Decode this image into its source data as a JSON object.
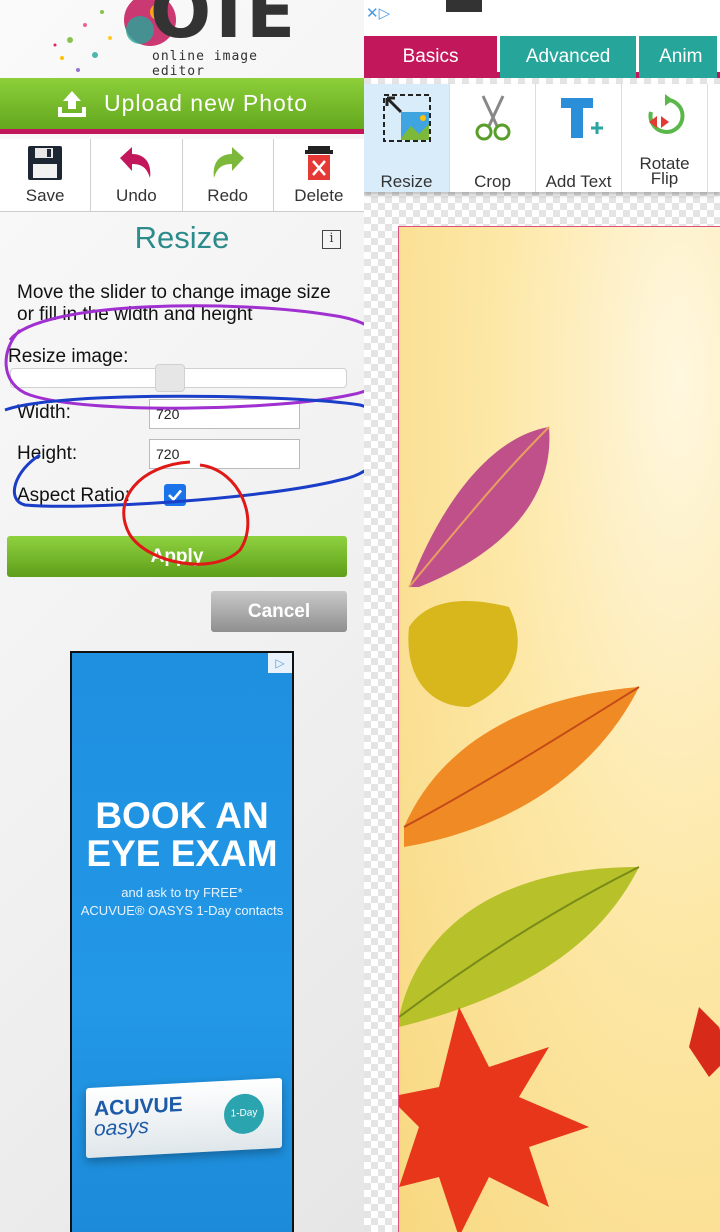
{
  "logo": {
    "text": "online image editor",
    "mark": "OIE"
  },
  "upload": {
    "label": "Upload new Photo"
  },
  "toolbar": {
    "save": "Save",
    "undo": "Undo",
    "redo": "Redo",
    "delete": "Delete"
  },
  "panel": {
    "title": "Resize",
    "info_icon": "i",
    "description": "Move the slider to change image size or fill in the width and height",
    "resize_label": "Resize image:",
    "width_label": "Width:",
    "width_value": "720",
    "height_label": "Height:",
    "height_value": "720",
    "aspect_label": "Aspect Ratio:",
    "aspect_checked": true,
    "apply": "Apply",
    "cancel": "Cancel"
  },
  "ad": {
    "headline": "BOOK AN EYE EXAM",
    "sub1": "and ask to try FREE*",
    "sub2": "ACUVUE® OASYS 1-Day contacts",
    "brand1": "ACUVUE",
    "brand2": "oasys",
    "seal": "1-Day",
    "choices_icon": "▷"
  },
  "topbar": {
    "close_icon": "✕▷"
  },
  "tabs": [
    {
      "label": "Basics",
      "color": "#c2185b"
    },
    {
      "label": "Advanced",
      "color": "#26a69a"
    },
    {
      "label": "Anim",
      "color": "#26a69a"
    }
  ],
  "tools": {
    "resize": "Resize",
    "crop": "Crop",
    "add_text": "Add Text",
    "rotate1": "Rotate",
    "rotate2": "Flip"
  },
  "colors": {
    "accent_green": "#6fb52c",
    "accent_pink": "#c2185b",
    "teal": "#26a69a"
  }
}
